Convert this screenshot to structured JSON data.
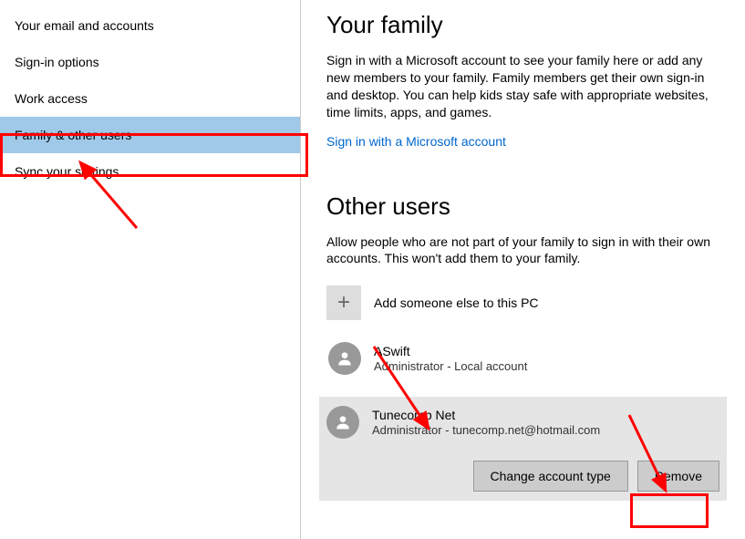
{
  "sidebar": {
    "items": [
      {
        "label": "Your email and accounts"
      },
      {
        "label": "Sign-in options"
      },
      {
        "label": "Work access"
      },
      {
        "label": "Family & other users"
      },
      {
        "label": "Sync your settings"
      }
    ],
    "selectedIndex": 3
  },
  "family": {
    "title": "Your family",
    "desc": "Sign in with a Microsoft account to see your family here or add any new members to your family. Family members get their own sign-in and desktop. You can help kids stay safe with appropriate websites, time limits, apps, and games.",
    "link": "Sign in with a Microsoft account"
  },
  "other": {
    "title": "Other users",
    "desc": "Allow people who are not part of your family to sign in with their own accounts. This won't add them to your family.",
    "addLabel": "Add someone else to this PC",
    "users": [
      {
        "name": "ASwift",
        "sub": "Administrator - Local account"
      },
      {
        "name": "Tunecomp Net",
        "sub": "Administrator - tunecomp.net@hotmail.com"
      }
    ],
    "selectedUserIndex": 1,
    "changeBtn": "Change account type",
    "removeBtn": "Remove"
  }
}
